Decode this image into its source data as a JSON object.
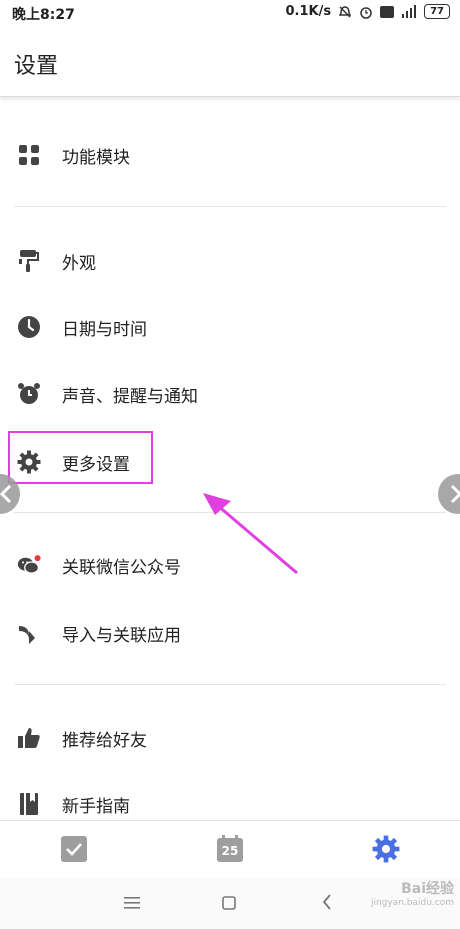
{
  "status_bar": {
    "time": "晚上8:27",
    "speed": "0.1K/s",
    "battery": "77"
  },
  "header": {
    "title": "设置"
  },
  "menu": [
    {
      "label": "功能模块",
      "icon": "grid-icon"
    },
    {
      "label": "外观",
      "icon": "paint-roller-icon"
    },
    {
      "label": "日期与时间",
      "icon": "clock-icon"
    },
    {
      "label": "声音、提醒与通知",
      "icon": "alarm-icon"
    },
    {
      "label": "更多设置",
      "icon": "gear-icon"
    },
    {
      "label": "关联微信公众号",
      "icon": "wechat-icon"
    },
    {
      "label": "导入与关联应用",
      "icon": "import-arrow-icon"
    },
    {
      "label": "推荐给好友",
      "icon": "thumbs-up-icon"
    },
    {
      "label": "新手指南",
      "icon": "book-icon"
    }
  ],
  "bottom_nav": {
    "calendar_day": "25",
    "active_color": "#4a6fe0"
  },
  "highlight_color": "#e040e0",
  "watermark": {
    "text": "Bai经验",
    "sub": "jingyan.baidu.com"
  }
}
